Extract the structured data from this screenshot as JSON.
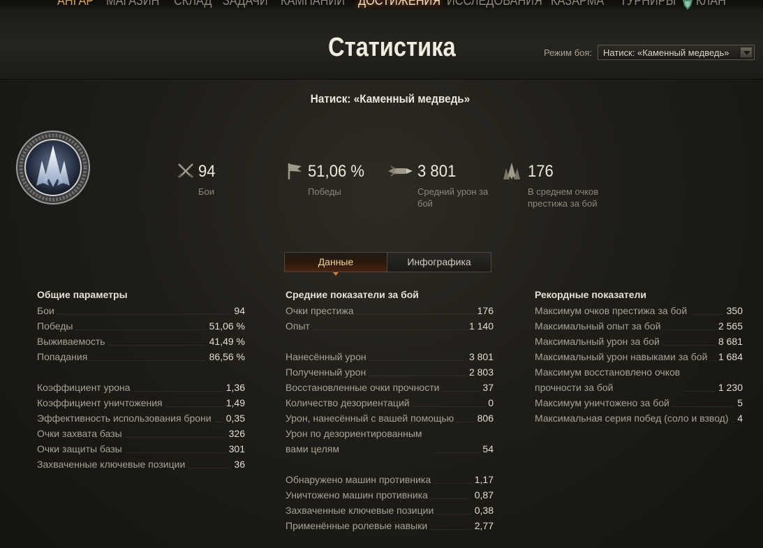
{
  "nav": {
    "items": [
      "АНГАР",
      "МАГАЗИН",
      "СКЛАД",
      "ЗАДАЧИ",
      "КАМПАНИИ",
      "ДОСТИЖЕНИЯ",
      "ИССЛЕДОВАНИЯ",
      "КАЗАРМА",
      "ТУРНИРЫ",
      "КЛАН"
    ],
    "active": "ДОСТИЖЕНИЯ"
  },
  "header": {
    "title": "Статистика",
    "mode_label": "Режим боя:",
    "mode_value": "Натиск: «Каменный медведь»"
  },
  "mode_heading": "Натиск: «Каменный медведь»",
  "summary": [
    {
      "icon": "crossed-swords-icon",
      "value": "94",
      "label": "Бои"
    },
    {
      "icon": "flag-icon",
      "value": "51,06 %",
      "label": "Победы"
    },
    {
      "icon": "shell-burst-icon",
      "value": "3 801",
      "label": "Средний урон за бой"
    },
    {
      "icon": "prestige-icon",
      "value": "176",
      "label": "В среднем очков престижа за бой"
    }
  ],
  "tabs": [
    "Данные",
    "Инфографика"
  ],
  "columns": {
    "general": {
      "title": "Общие параметры",
      "groups": [
        [
          {
            "name": "Бои",
            "value": "94"
          },
          {
            "name": "Победы",
            "value": "51,06 %"
          },
          {
            "name": "Выживаемость",
            "value": "41,49 %"
          },
          {
            "name": "Попадания",
            "value": "86,56 %"
          }
        ],
        [
          {
            "name": "Коэффициент урона",
            "value": "1,36"
          },
          {
            "name": "Коэффициент уничтожения",
            "value": "1,49"
          },
          {
            "name": "Эффективность использования брони",
            "value": "0,35"
          },
          {
            "name": "Очки захвата базы",
            "value": "326"
          },
          {
            "name": "Очки защиты базы",
            "value": "301"
          },
          {
            "name": "Захваченные ключевые позиции",
            "value": "36"
          }
        ]
      ]
    },
    "average": {
      "title": "Средние показатели за бой",
      "groups": [
        [
          {
            "name": "Очки престижа",
            "value": "176"
          },
          {
            "name": "Опыт",
            "value": "1 140"
          }
        ],
        [
          {
            "name": "Нанесённый урон",
            "value": "3 801"
          },
          {
            "name": "Полученный урон",
            "value": "2 803"
          },
          {
            "name": "Восстановленные очки прочности",
            "value": "37"
          },
          {
            "name": "Количество дезориентаций",
            "value": "0"
          },
          {
            "name": "Урон, нанесённый с вашей помощью",
            "value": "806"
          },
          {
            "name": "Урон по дезориентированным вами целям",
            "value": "54"
          }
        ],
        [
          {
            "name": "Обнаружено машин противника",
            "value": "1,17"
          },
          {
            "name": "Уничтожено машин противника",
            "value": "0,87"
          },
          {
            "name": "Захваченные ключевые позиции",
            "value": "0,38"
          },
          {
            "name": "Применённые ролевые навыки",
            "value": "2,77"
          }
        ]
      ]
    },
    "records": {
      "title": "Рекордные показатели",
      "groups": [
        [
          {
            "name": "Максимум очков престижа за бой",
            "value": "350"
          },
          {
            "name": "Максимальный опыт за бой",
            "value": "2 565"
          },
          {
            "name": "Максимальный урон за бой",
            "value": "8 681"
          },
          {
            "name": "Максимальный урон навыками за бой",
            "value": "1 684"
          },
          {
            "name": "Максимум восстановлено очков прочности за бой",
            "value": "1 230"
          },
          {
            "name": "Максимум уничтожено за бой",
            "value": "5"
          },
          {
            "name": "Максимальная серия побед (соло и взвод)",
            "value": "4"
          }
        ]
      ]
    }
  }
}
